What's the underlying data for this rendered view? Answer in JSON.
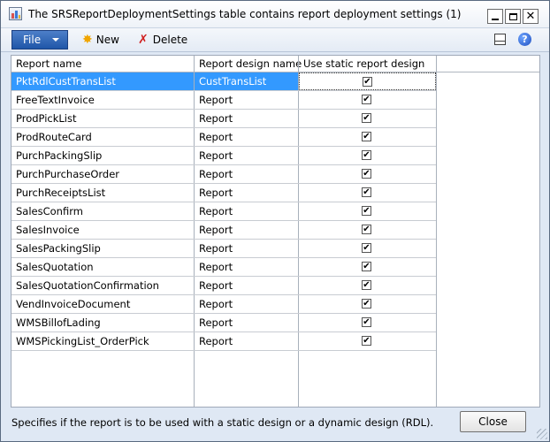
{
  "window": {
    "title": "The SRSReportDeploymentSettings table contains report deployment settings (1)"
  },
  "title_buttons": {
    "minimize": "minimize-icon",
    "maximize": "maximize-icon",
    "close": "close-icon"
  },
  "toolbar": {
    "file_label": "File",
    "new_label": "New",
    "delete_label": "Delete"
  },
  "grid": {
    "columns": [
      "Report name",
      "Report design name",
      "Use static report design"
    ],
    "rows": [
      {
        "name": "PktRdlCustTransList",
        "design": "CustTransList",
        "static": true,
        "selected": true
      },
      {
        "name": "FreeTextInvoice",
        "design": "Report",
        "static": true
      },
      {
        "name": "ProdPickList",
        "design": "Report",
        "static": true
      },
      {
        "name": "ProdRouteCard",
        "design": "Report",
        "static": true
      },
      {
        "name": "PurchPackingSlip",
        "design": "Report",
        "static": true
      },
      {
        "name": "PurchPurchaseOrder",
        "design": "Report",
        "static": true
      },
      {
        "name": "PurchReceiptsList",
        "design": "Report",
        "static": true
      },
      {
        "name": "SalesConfirm",
        "design": "Report",
        "static": true
      },
      {
        "name": "SalesInvoice",
        "design": "Report",
        "static": true
      },
      {
        "name": "SalesPackingSlip",
        "design": "Report",
        "static": true
      },
      {
        "name": "SalesQuotation",
        "design": "Report",
        "static": true
      },
      {
        "name": "SalesQuotationConfirmation",
        "design": "Report",
        "static": true
      },
      {
        "name": "VendInvoiceDocument",
        "design": "Report",
        "static": true
      },
      {
        "name": "WMSBillofLading",
        "design": "Report",
        "static": true
      },
      {
        "name": "WMSPickingList_OrderPick",
        "design": "Report",
        "static": true
      }
    ]
  },
  "status": {
    "text": "Specifies if the report is to be used with a static design or a dynamic design (RDL).",
    "close_label": "Close"
  },
  "colors": {
    "selection": "#3399ff",
    "file_button": "#1f56a8",
    "frame": "#dfe8f4"
  }
}
